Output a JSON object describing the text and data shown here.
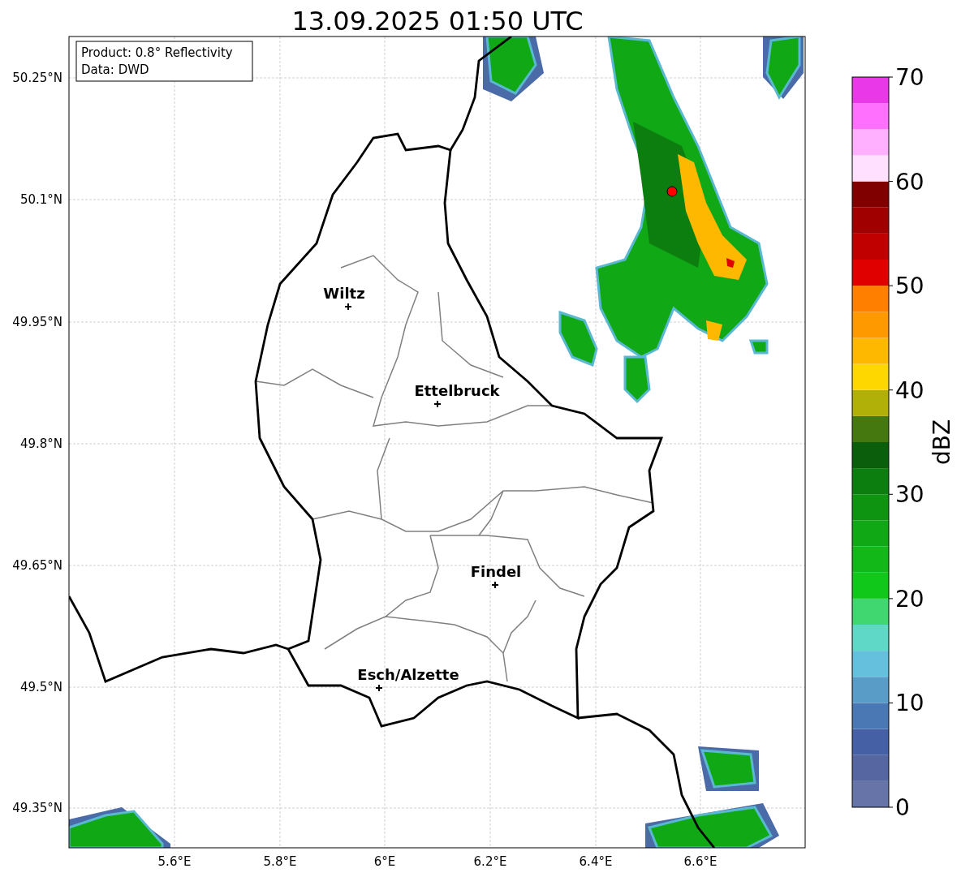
{
  "title": "13.09.2025 01:50 UTC",
  "info_box": [
    "Product: 0.8° Reflectivity",
    "Data: DWD"
  ],
  "map": {
    "x_ticks": [
      "5.6°E",
      "5.8°E",
      "6°E",
      "6.2°E",
      "6.4°E",
      "6.6°E"
    ],
    "y_ticks": [
      "50.25°N",
      "50.1°N",
      "49.95°N",
      "49.8°N",
      "49.65°N",
      "49.5°N",
      "49.35°N"
    ],
    "cities": [
      {
        "name": "Wiltz"
      },
      {
        "name": "Ettelbruck"
      },
      {
        "name": "Findel"
      },
      {
        "name": "Esch/Alzette"
      }
    ]
  },
  "colorbar": {
    "label": "dBZ",
    "ticks": [
      "70",
      "60",
      "50",
      "40",
      "30",
      "20",
      "10",
      "0"
    ],
    "bands": [
      {
        "color": "#6674a8"
      },
      {
        "color": "#5566a0"
      },
      {
        "color": "#4560a4"
      },
      {
        "color": "#4a78b4"
      },
      {
        "color": "#5a9cc8"
      },
      {
        "color": "#64c0dc"
      },
      {
        "color": "#60d8c8"
      },
      {
        "color": "#40d670"
      },
      {
        "color": "#10c81a"
      },
      {
        "color": "#12b818"
      },
      {
        "color": "#10a814"
      },
      {
        "color": "#0f9412"
      },
      {
        "color": "#0c7e10"
      },
      {
        "color": "#0a5e0c"
      },
      {
        "color": "#467810"
      },
      {
        "color": "#b0b008"
      },
      {
        "color": "#ffd700"
      },
      {
        "color": "#ffb800"
      },
      {
        "color": "#ff9900"
      },
      {
        "color": "#ff7f00"
      },
      {
        "color": "#e00000"
      },
      {
        "color": "#c00000"
      },
      {
        "color": "#a00000"
      },
      {
        "color": "#800000"
      },
      {
        "color": "#ffe0ff"
      },
      {
        "color": "#ffb0ff"
      },
      {
        "color": "#ff70ff"
      },
      {
        "color": "#e838e8"
      }
    ]
  }
}
